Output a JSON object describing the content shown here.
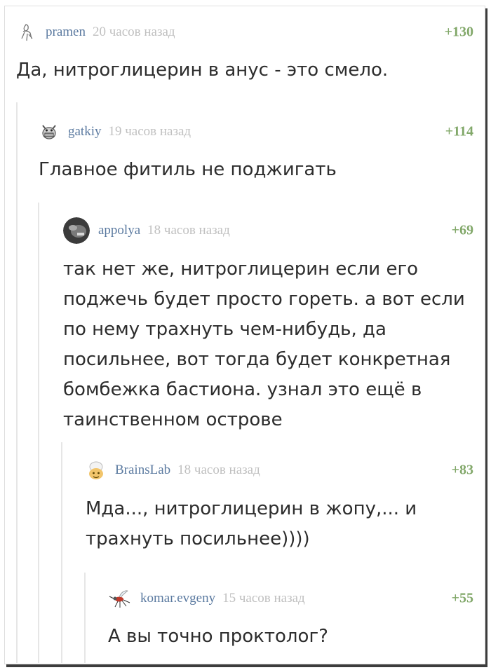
{
  "comments": [
    {
      "user": "pramen",
      "time": "20 часов назад",
      "rating": "+130",
      "text": "Да, нитроглицерин в анус - это смело.",
      "avatar_icon": "sketch-figure-icon"
    },
    {
      "user": "gatkiy",
      "time": "19 часов назад",
      "rating": "+114",
      "text": "Главное фитиль не поджигать",
      "avatar_icon": "grinning-creature-icon"
    },
    {
      "user": "appolya",
      "time": "18 часов назад",
      "rating": "+69",
      "text": "так нет же, нитроглицерин если его\nподжечь будет просто гореть. а вот если\nпо нему трахнуть чем-нибудь, да\nпосильнее, вот тогда будет конкретная\nбомбежка бастиона. узнал это ещё в\nтаинственном острове",
      "avatar_icon": "dark-photo-avatar-icon"
    },
    {
      "user": "BrainsLab",
      "time": "18 часов назад",
      "rating": "+83",
      "text": "Мда..., нитроглицерин в жопу,... и\nтрахнуть посильнее))))",
      "avatar_icon": "cartoon-head-icon"
    },
    {
      "user": "komar.evgeny",
      "time": "15 часов назад",
      "rating": "+55",
      "text": "А вы точно проктолог?",
      "avatar_icon": "mosquito-icon"
    }
  ],
  "colors": {
    "username": "#5b7aa0",
    "time": "#c0c0c0",
    "rating": "#82a86a",
    "thread_line": "#e6e6e6",
    "text": "#2d2d2d"
  }
}
